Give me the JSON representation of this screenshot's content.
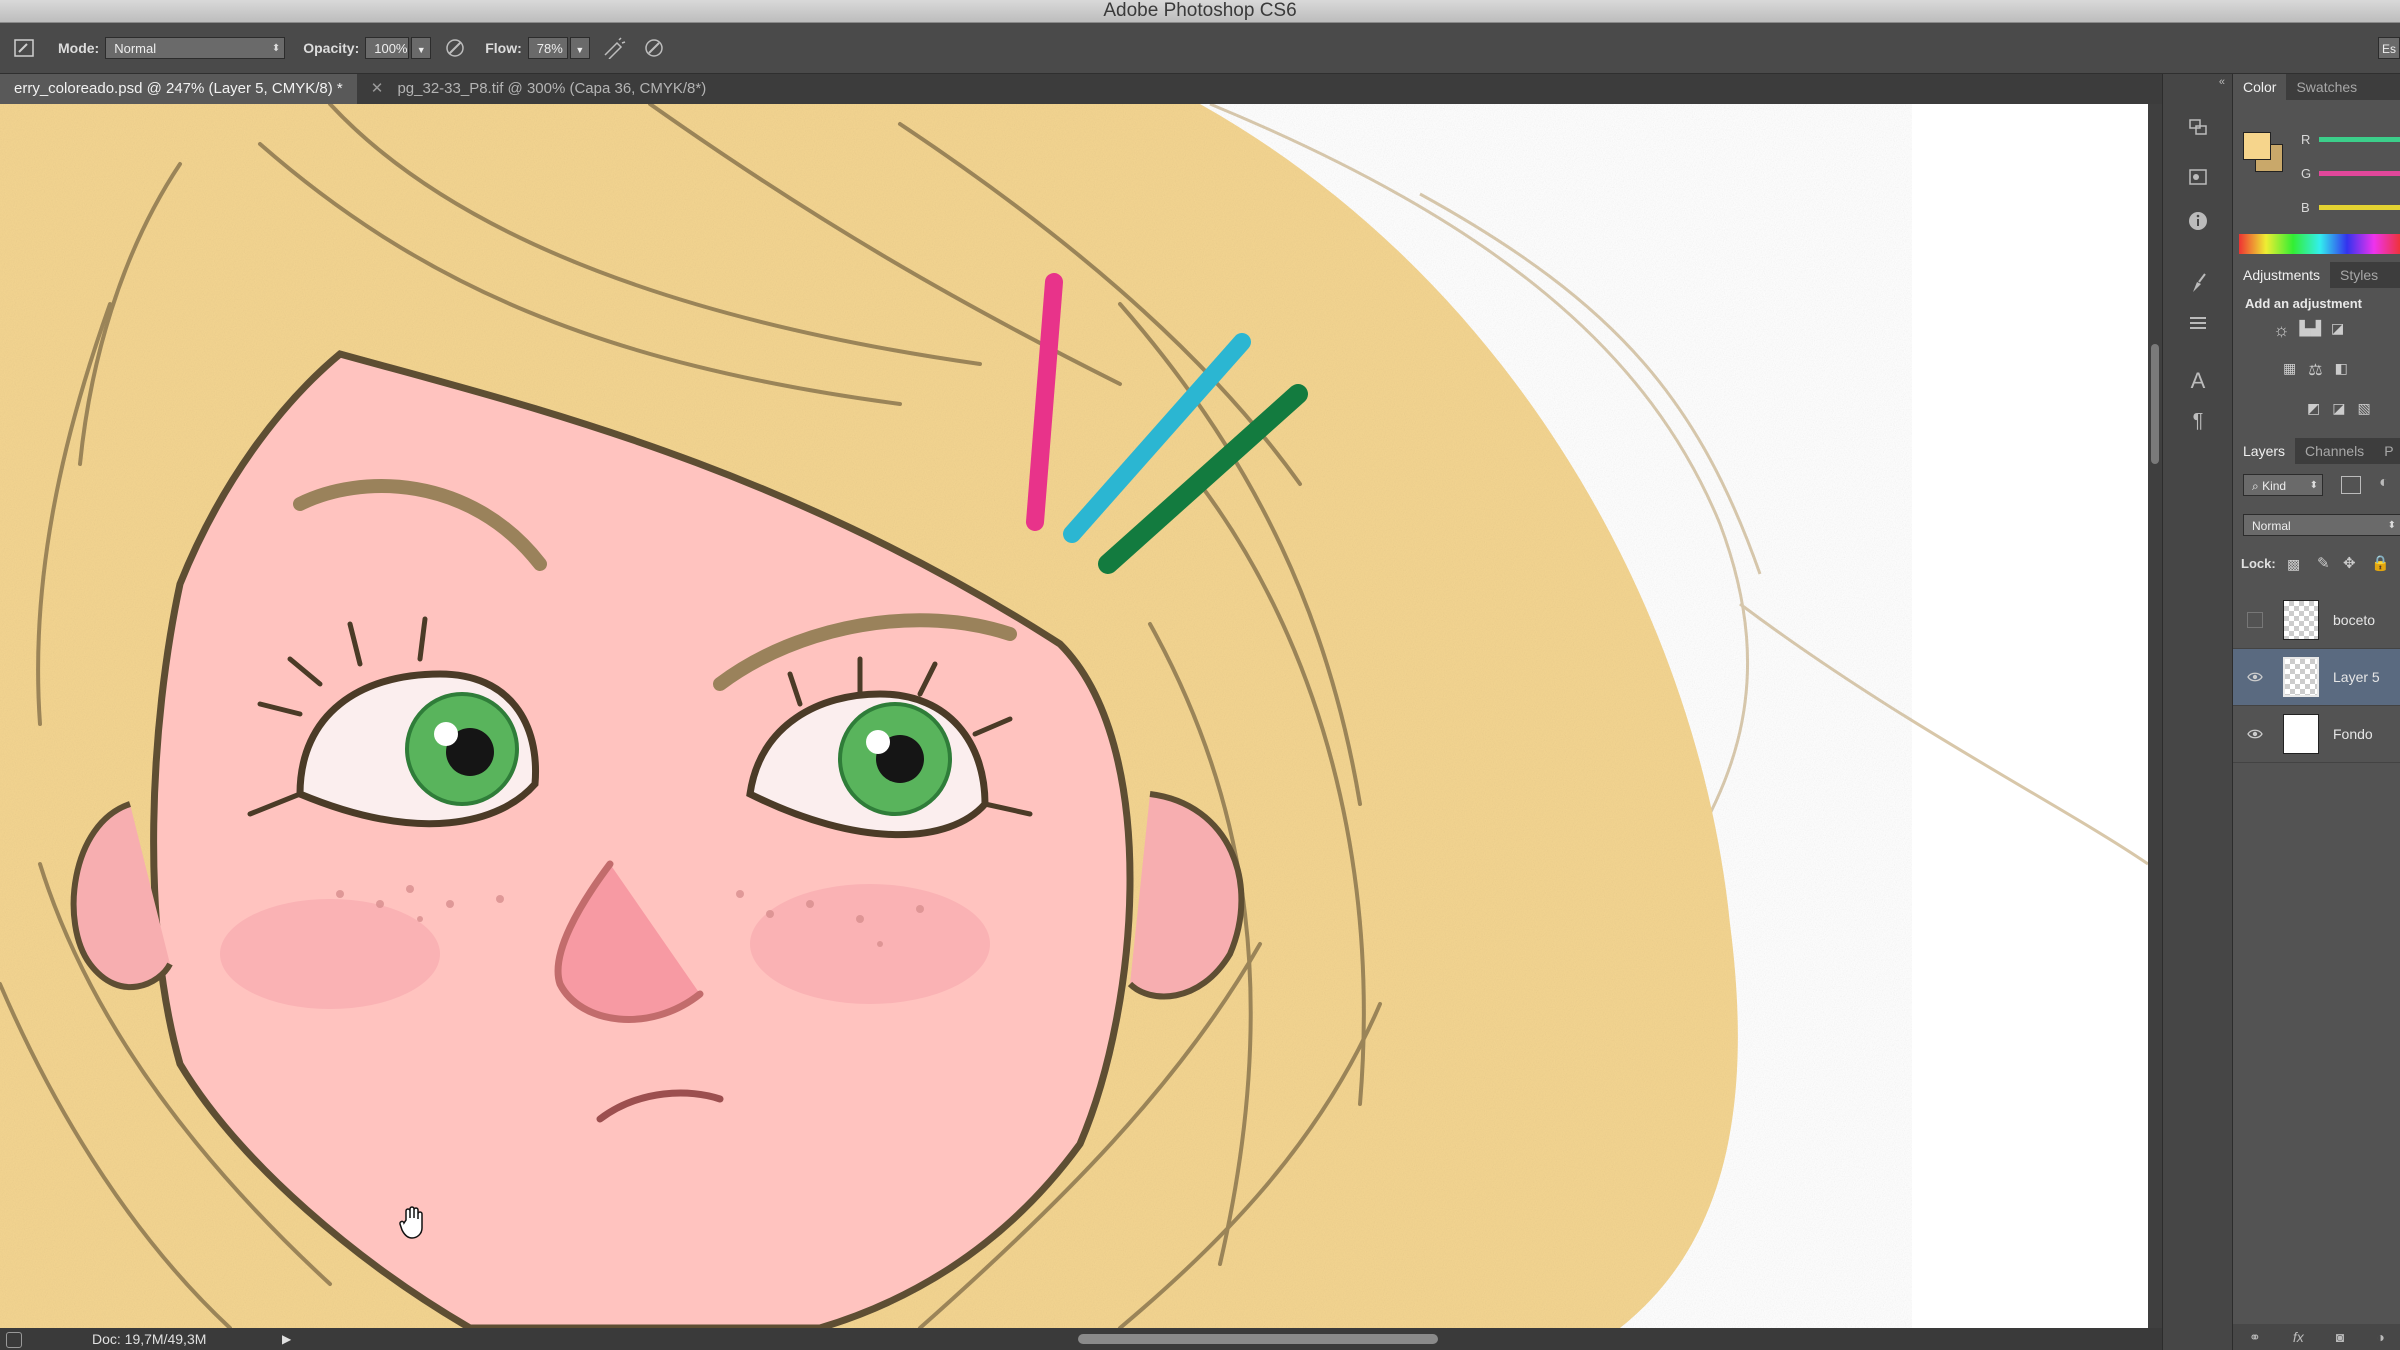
{
  "app": {
    "title": "Adobe Photoshop CS6"
  },
  "options": {
    "mode_label": "Mode:",
    "mode_value": "Normal",
    "opacity_label": "Opacity:",
    "opacity_value": "100%",
    "flow_label": "Flow:",
    "flow_value": "78%",
    "workspace_cut": "Es"
  },
  "tabs": [
    {
      "label": "erry_coloreado.psd @ 247% (Layer 5, CMYK/8) *",
      "active": true
    },
    {
      "label": "pg_32-33_P8.tif @ 300% (Capa 36, CMYK/8*)",
      "active": false
    }
  ],
  "status": {
    "doc": "Doc: 19,7M/49,3M"
  },
  "panels": {
    "color_tabs": [
      "Color",
      "Swatches"
    ],
    "color": {
      "foreground": "#f6d58c",
      "background": "#c9a86a",
      "channels": [
        "R",
        "G",
        "B"
      ]
    },
    "adjustments_tabs": [
      "Adjustments",
      "Styles"
    ],
    "adjustments_hint": "Add an adjustment",
    "layers_tabs": [
      "Layers",
      "Channels",
      "P"
    ],
    "kind_filter": "Kind",
    "blend_mode": "Normal",
    "lock_label": "Lock:",
    "layers": [
      {
        "name": "boceto",
        "visible": false,
        "selected": false
      },
      {
        "name": "Layer 5",
        "visible": true,
        "selected": true
      },
      {
        "name": "Fondo",
        "visible": true,
        "selected": false
      }
    ]
  },
  "colors": {
    "hair": "#f6d894",
    "skin": "#ffc4c0",
    "outline": "#6b5a3c",
    "eye_green": "#59b45c",
    "clip_pink": "#e8338a",
    "clip_cyan": "#2bb6d2",
    "clip_green": "#137b3f"
  }
}
